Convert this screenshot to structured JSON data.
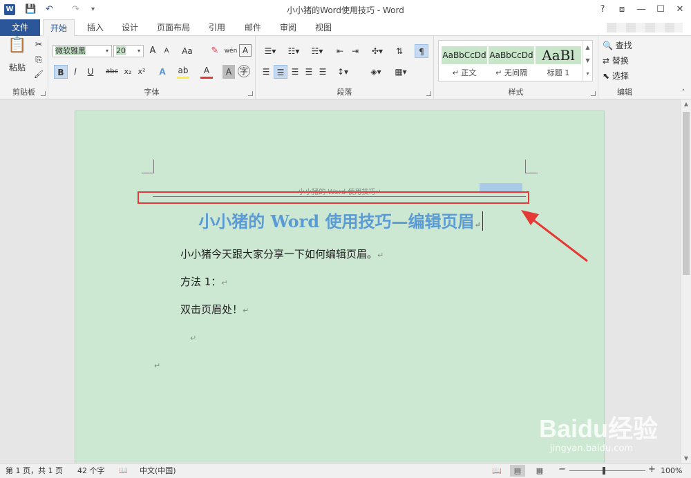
{
  "titlebar": {
    "app_icon": "W",
    "title": "小小猪的Word使用技巧 - Word",
    "qat": {
      "save": "💾",
      "undo": "↶",
      "redo": "↷",
      "customize": "▾"
    },
    "controls": {
      "help": "?",
      "ribbon_options": "⧈",
      "minimize": "—",
      "maximize": "☐",
      "close": "✕"
    }
  },
  "tabs": {
    "file": "文件",
    "items": [
      "开始",
      "插入",
      "设计",
      "页面布局",
      "引用",
      "邮件",
      "审阅",
      "视图"
    ],
    "active": "开始"
  },
  "ribbon": {
    "clipboard": {
      "label": "剪贴板",
      "paste": "粘贴",
      "cut_icon": "✂",
      "copy_icon": "⎘",
      "format_painter_icon": "🖌"
    },
    "font": {
      "label": "字体",
      "font_name": "微软雅黑",
      "font_size": "20",
      "grow": "A",
      "shrink": "A",
      "change_case": "Aa",
      "bold": "B",
      "italic": "I",
      "underline": "U",
      "strikethrough": "abc",
      "subscript": "x₂",
      "superscript": "x²"
    },
    "paragraph": {
      "label": "段落"
    },
    "styles": {
      "label": "样式",
      "items": [
        {
          "sample": "AaBbCcDd",
          "name": "↵ 正文"
        },
        {
          "sample": "AaBbCcDd",
          "name": "↵ 无间隔"
        },
        {
          "sample": "AaBl",
          "name": "标题 1"
        }
      ]
    },
    "editing": {
      "label": "编辑",
      "find": "查找",
      "replace": "替换",
      "select": "选择"
    }
  },
  "document": {
    "header_text": "小小猪的 Word 使用技巧↵",
    "title": "小小猪的 Word 使用技巧—编辑页眉",
    "paragraphs": [
      "小小猪今天跟大家分享一下如何编辑页眉。",
      "方法 1：",
      "双击页眉处！"
    ],
    "paragraph_mark": "↵"
  },
  "statusbar": {
    "page": "第 1 页，共 1 页",
    "words": "42 个字",
    "proofing_icon": "📖",
    "language": "中文(中国)",
    "zoom_out": "−",
    "zoom_in": "+",
    "zoom": "100%"
  },
  "watermark": {
    "main": "Baidu经验",
    "sub": "jingyan.baidu.com"
  },
  "colors": {
    "accent": "#2b579a",
    "page_bg": "#cde8d2",
    "title_blue": "#5b9bd5",
    "highlight_red": "#e53935"
  }
}
